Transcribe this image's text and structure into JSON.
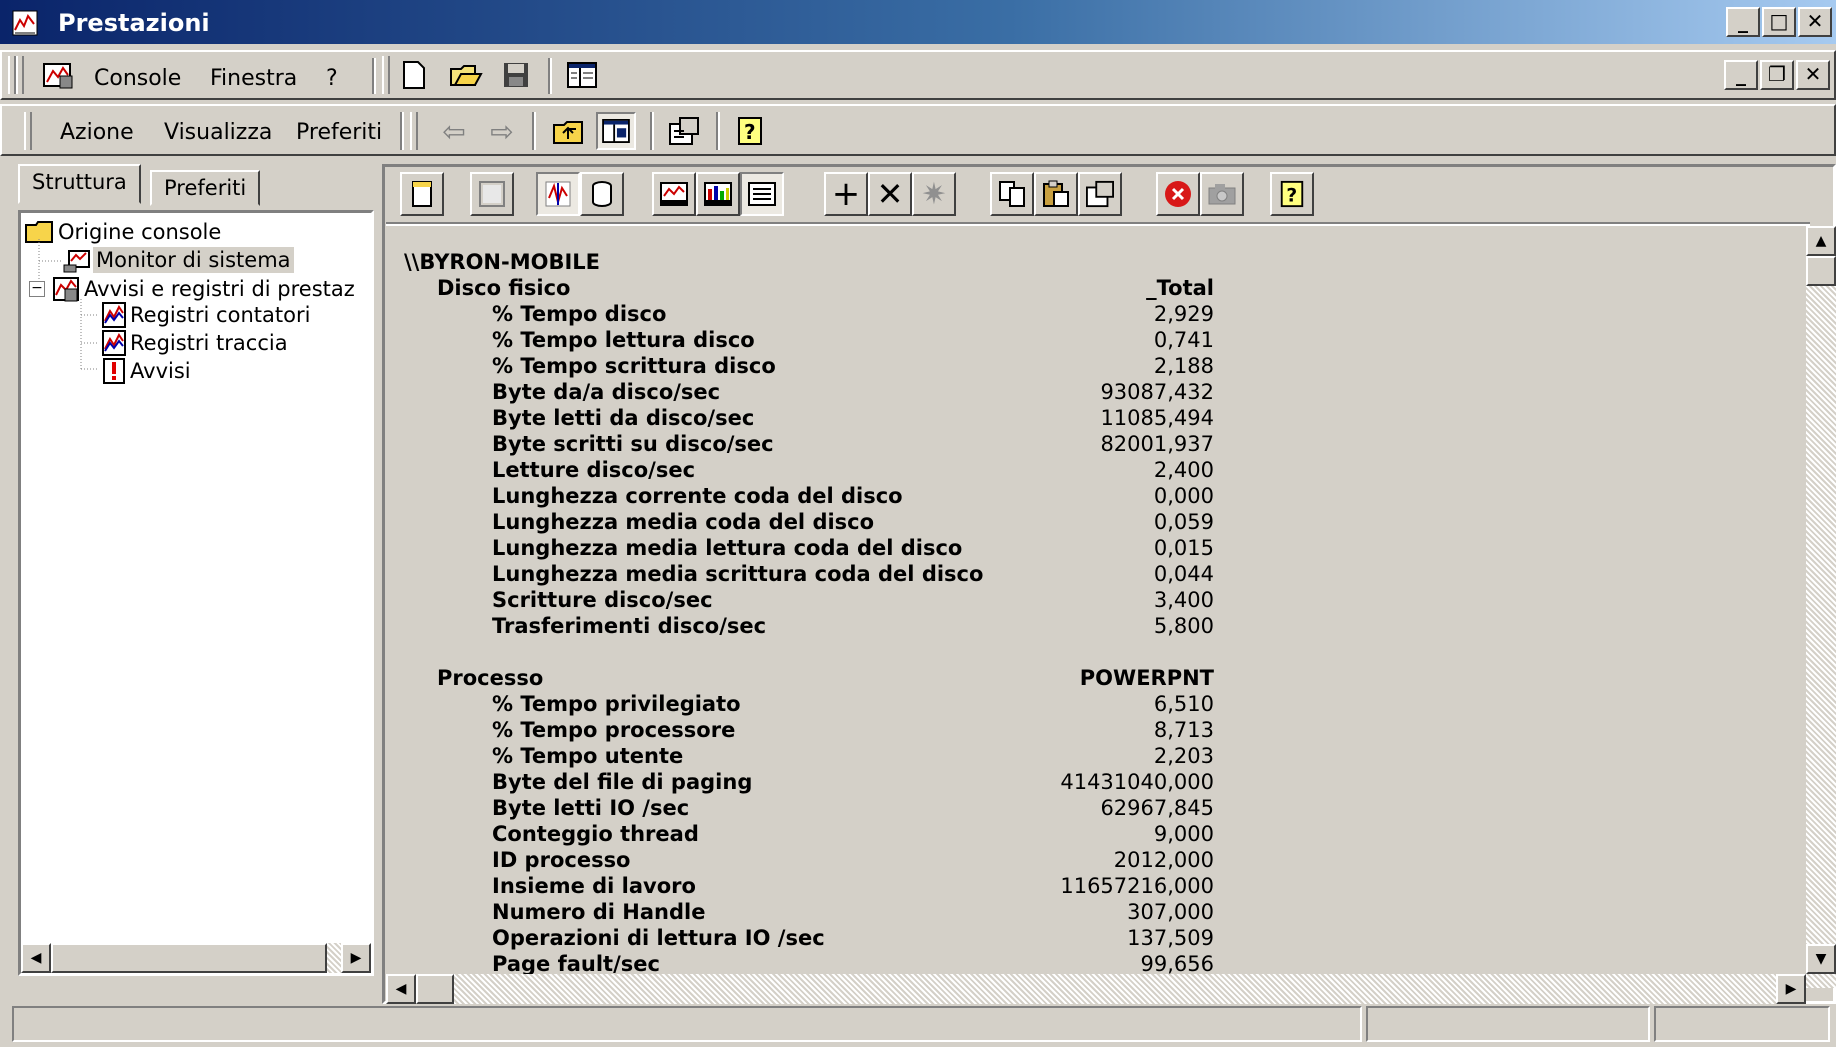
{
  "window": {
    "title": "Prestazioni"
  },
  "menubar": {
    "items": [
      {
        "label": "Console"
      },
      {
        "label": "Finestra"
      },
      {
        "label": "?"
      }
    ]
  },
  "actionbar": {
    "items": [
      {
        "label": "Azione"
      },
      {
        "label": "Visualizza"
      },
      {
        "label": "Preferiti"
      }
    ]
  },
  "tabs": [
    {
      "label": "Struttura",
      "active": true
    },
    {
      "label": "Preferiti",
      "active": false
    }
  ],
  "tree": {
    "root": "Origine console",
    "items": [
      {
        "label": "Monitor di sistema",
        "icon": "system-monitor-icon"
      },
      {
        "label": "Avvisi e registri di prestaz",
        "icon": "performance-logs-icon"
      },
      {
        "label": "Registri contatori",
        "icon": "counter-log-icon"
      },
      {
        "label": "Registri traccia",
        "icon": "trace-log-icon"
      },
      {
        "label": "Avvisi",
        "icon": "alert-icon"
      }
    ]
  },
  "report": {
    "machine": "\\\\BYRON-MOBILE",
    "objects": [
      {
        "name": "Disco fisico",
        "instance": "_Total",
        "counters": [
          {
            "name": "% Tempo disco",
            "value": "2,929"
          },
          {
            "name": "% Tempo lettura disco",
            "value": "0,741"
          },
          {
            "name": "% Tempo scrittura disco",
            "value": "2,188"
          },
          {
            "name": "Byte da/a disco/sec",
            "value": "93087,432"
          },
          {
            "name": "Byte letti da disco/sec",
            "value": "11085,494"
          },
          {
            "name": "Byte scritti su disco/sec",
            "value": "82001,937"
          },
          {
            "name": "Letture disco/sec",
            "value": "2,400"
          },
          {
            "name": "Lunghezza corrente coda del disco",
            "value": "0,000"
          },
          {
            "name": "Lunghezza media coda del disco",
            "value": "0,059"
          },
          {
            "name": "Lunghezza media lettura coda del disco",
            "value": "0,015"
          },
          {
            "name": "Lunghezza media scrittura coda del disco",
            "value": "0,044"
          },
          {
            "name": "Scritture disco/sec",
            "value": "3,400"
          },
          {
            "name": "Trasferimenti disco/sec",
            "value": "5,800"
          }
        ]
      },
      {
        "name": "Processo",
        "instance": "POWERPNT",
        "counters": [
          {
            "name": "% Tempo privilegiato",
            "value": "6,510"
          },
          {
            "name": "% Tempo processore",
            "value": "8,713"
          },
          {
            "name": "% Tempo utente",
            "value": "2,203"
          },
          {
            "name": "Byte del file di paging",
            "value": "41431040,000"
          },
          {
            "name": "Byte letti IO /sec",
            "value": "62967,845"
          },
          {
            "name": "Conteggio thread",
            "value": "9,000"
          },
          {
            "name": "ID processo",
            "value": "2012,000"
          },
          {
            "name": "Insieme di lavoro",
            "value": "11657216,000"
          },
          {
            "name": "Numero di Handle",
            "value": "307,000"
          },
          {
            "name": "Operazioni di lettura IO /sec",
            "value": "137,509"
          },
          {
            "name": "Page fault/sec",
            "value": "99,656"
          }
        ]
      }
    ]
  },
  "colors": {
    "title_gradient_start": "#0a246a",
    "title_gradient_end": "#a6caf0",
    "face": "#d4d0c8",
    "delete_button_red": "#d81818"
  }
}
